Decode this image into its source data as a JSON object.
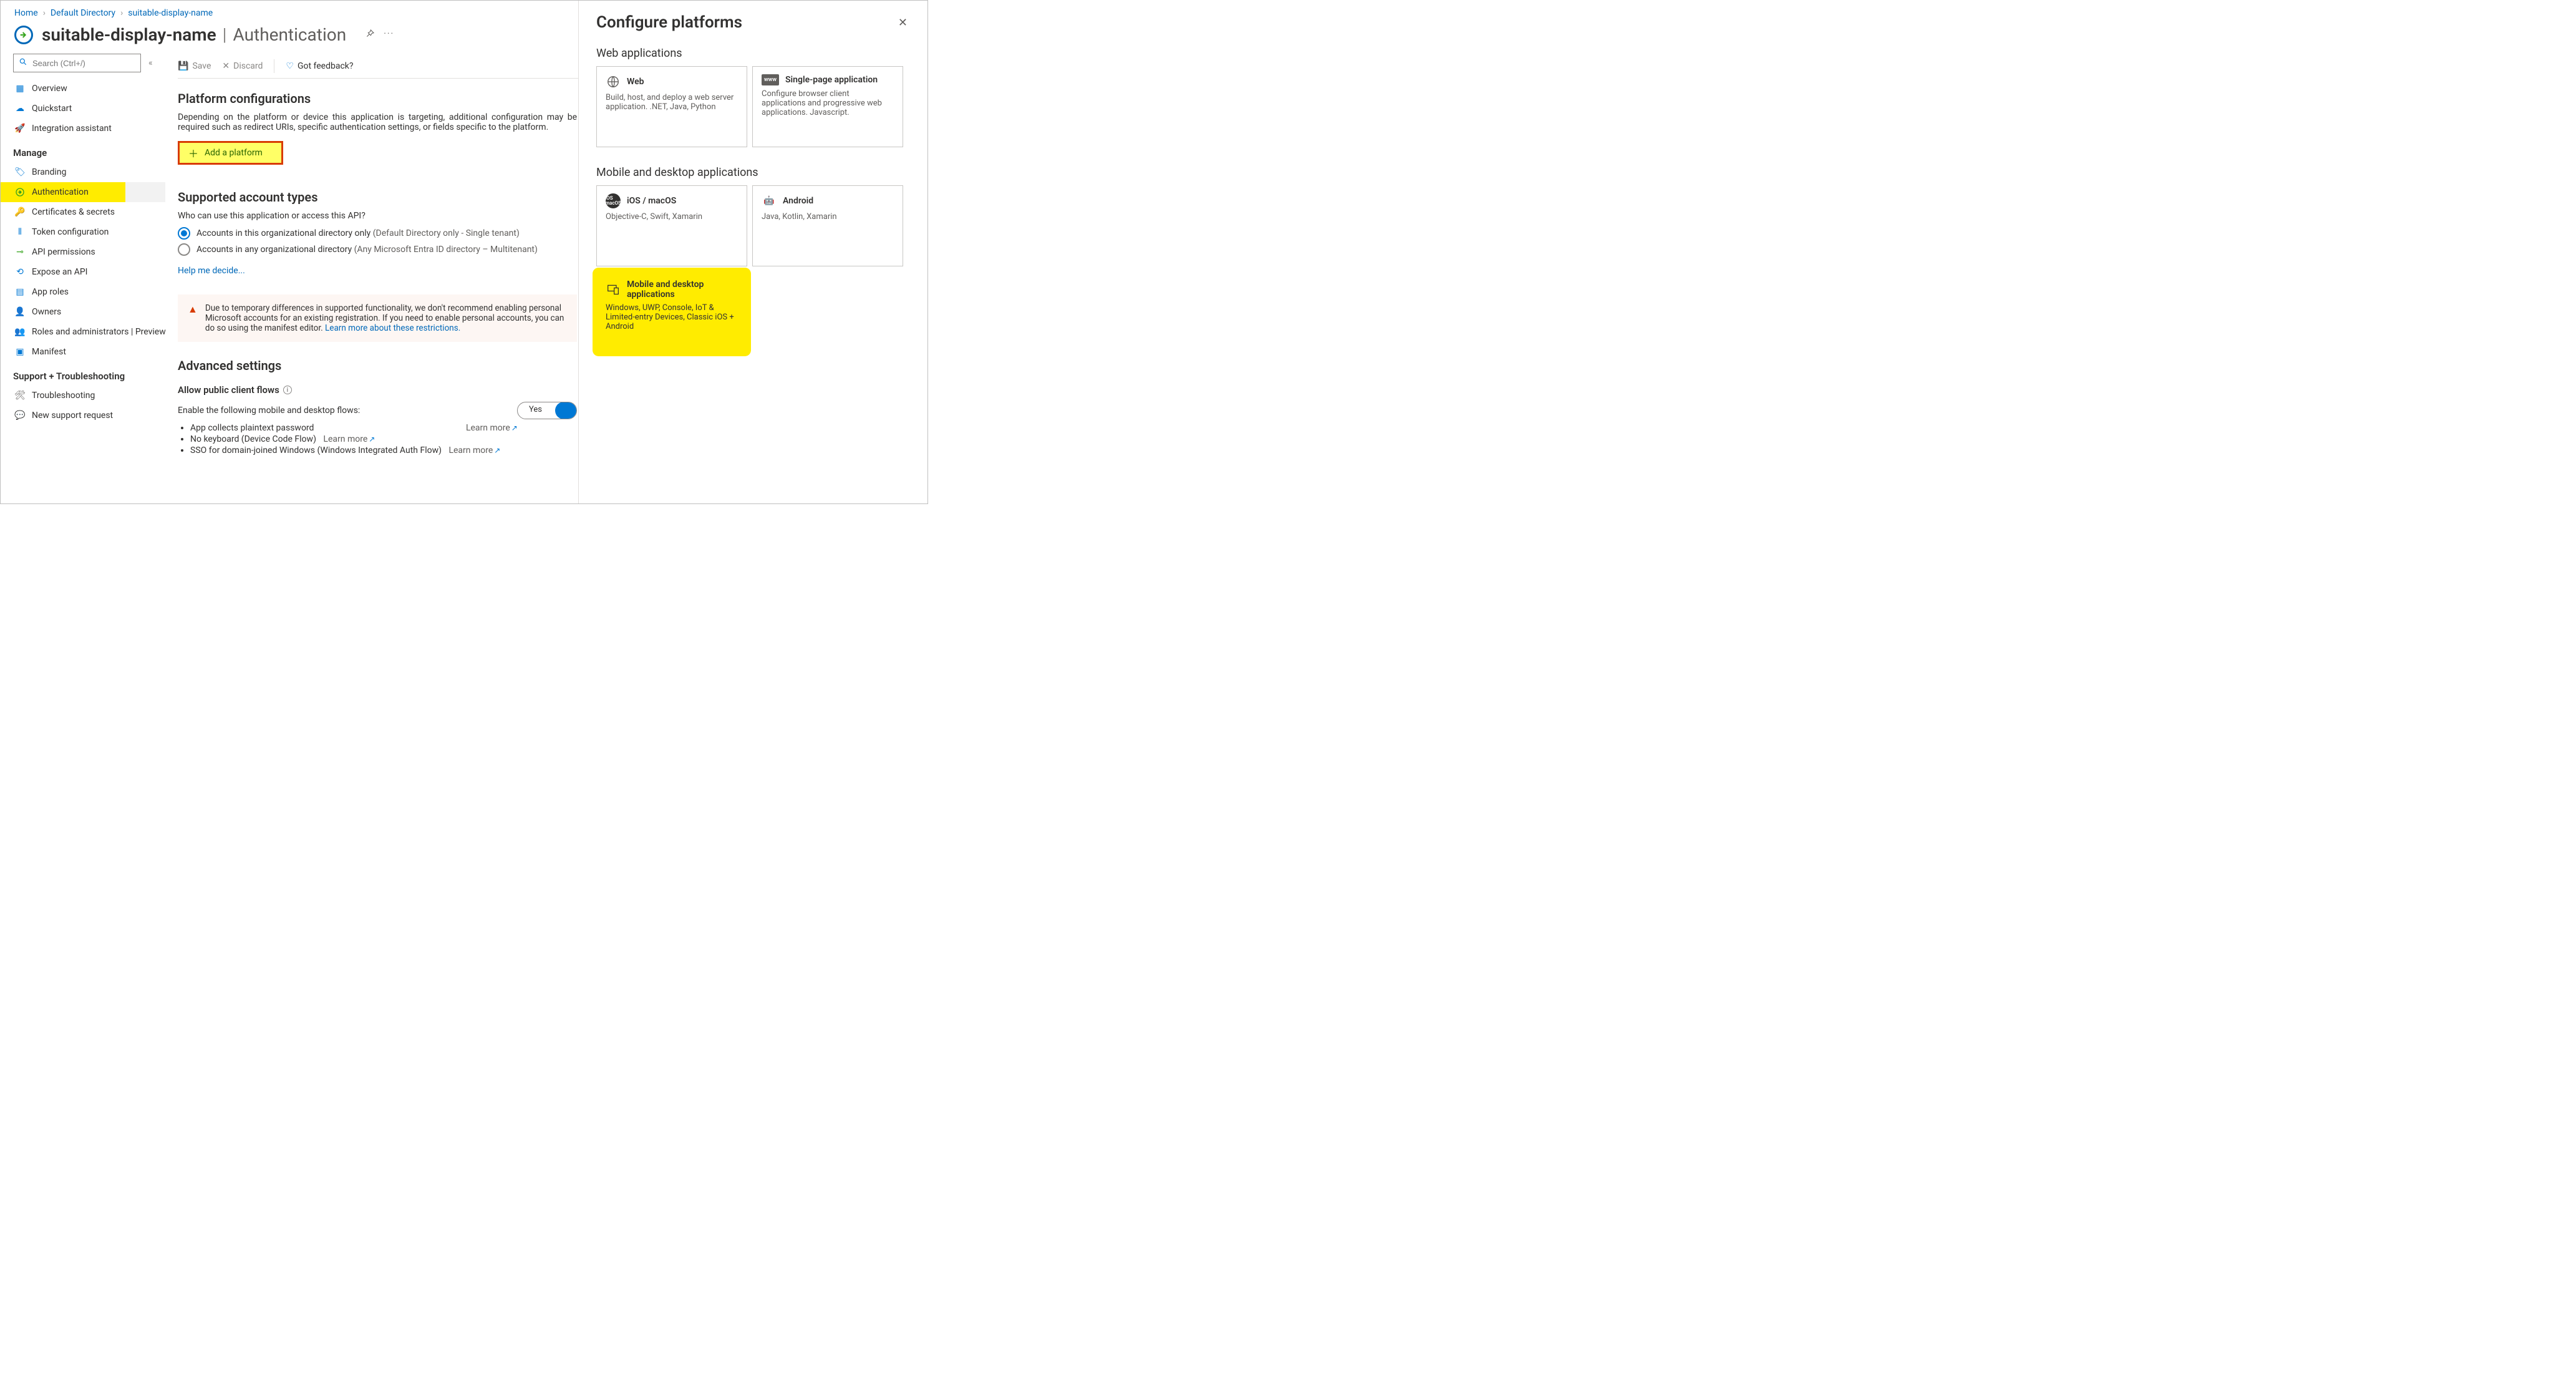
{
  "breadcrumb": {
    "home": "Home",
    "dir": "Default Directory",
    "app": "suitable-display-name"
  },
  "title": {
    "app": "suitable-display-name",
    "page": "Authentication"
  },
  "sidebar": {
    "search_placeholder": "Search (Ctrl+/)",
    "top": [
      {
        "icon": "grid",
        "label": "Overview"
      },
      {
        "icon": "cloud",
        "label": "Quickstart"
      },
      {
        "icon": "rocket",
        "label": "Integration assistant"
      }
    ],
    "manage_label": "Manage",
    "manage": [
      {
        "icon": "tag",
        "label": "Branding"
      },
      {
        "icon": "auth",
        "label": "Authentication",
        "highlight": true
      },
      {
        "icon": "key",
        "label": "Certificates & secrets"
      },
      {
        "icon": "bars",
        "label": "Token configuration"
      },
      {
        "icon": "api",
        "label": "API permissions"
      },
      {
        "icon": "expose",
        "label": "Expose an API"
      },
      {
        "icon": "approles",
        "label": "App roles"
      },
      {
        "icon": "owners",
        "label": "Owners"
      },
      {
        "icon": "roles",
        "label": "Roles and administrators | Preview"
      },
      {
        "icon": "manifest",
        "label": "Manifest"
      }
    ],
    "support_label": "Support + Troubleshooting",
    "support": [
      {
        "icon": "wrench",
        "label": "Troubleshooting"
      },
      {
        "icon": "ticket",
        "label": "New support request"
      }
    ]
  },
  "toolbar": {
    "save": "Save",
    "discard": "Discard",
    "feedback": "Got feedback?"
  },
  "sections": {
    "platform_title": "Platform configurations",
    "platform_desc": "Depending on the platform or device this application is targeting, additional configuration may be required such as redirect URIs, specific authentication settings, or fields specific to the platform.",
    "add_platform": "Add a platform",
    "supported_title": "Supported account types",
    "supported_question": "Who can use this application or access this API?",
    "radio1_main": "Accounts in this organizational directory only ",
    "radio1_sub": "(Default Directory only - Single tenant)",
    "radio2_main": "Accounts in any organizational directory ",
    "radio2_sub": "(Any Microsoft Entra ID directory – Multitenant)",
    "help_decide": "Help me decide...",
    "alert_text": "Due to temporary differences in supported functionality, we don't recommend enabling personal Microsoft accounts for an existing registration. If you need to enable personal accounts, you can do so using the manifest editor. ",
    "alert_link": "Learn more about these restrictions.",
    "advanced_title": "Advanced settings",
    "allow_public": "Allow public client flows",
    "enable_flows": "Enable the following mobile and desktop flows:",
    "flow1": "App collects plaintext password",
    "flow1_learn": "Learn more",
    "flow2": "No keyboard (Device Code Flow) ",
    "flow2_learn": "Learn more",
    "flow3": "SSO for domain-joined Windows (Windows Integrated Auth Flow) ",
    "flow3_learn": "Learn more",
    "toggle_yes": "Yes"
  },
  "panel": {
    "title": "Configure platforms",
    "web_section": "Web applications",
    "web_tile_title": "Web",
    "web_tile_desc": "Build, host, and deploy a web server application. .NET, Java, Python",
    "spa_tile_title": "Single-page application",
    "spa_tile_desc": "Configure browser client applications and progressive web applications. Javascript.",
    "mobile_section": "Mobile and desktop applications",
    "ios_title": "iOS / macOS",
    "ios_desc": "Objective-C, Swift, Xamarin",
    "android_title": "Android",
    "android_desc": "Java, Kotlin, Xamarin",
    "desktop_title": "Mobile and desktop applications",
    "desktop_desc": "Windows, UWP, Console, IoT & Limited-entry Devices, Classic iOS + Android"
  }
}
